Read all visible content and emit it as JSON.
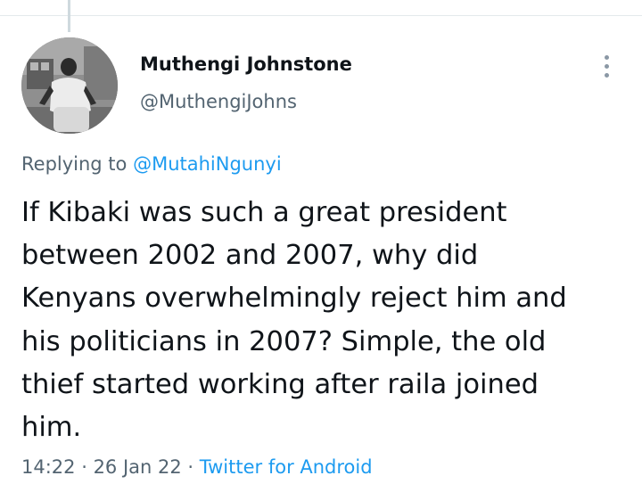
{
  "user": {
    "display_name": "Muthengi Johnstone",
    "handle": "@MuthengiJohns",
    "avatar_icon": "profile-photo"
  },
  "reply": {
    "prefix": "Replying to ",
    "mention": "@MutahiNgunyi"
  },
  "tweet": {
    "lines": [
      "If Kibaki was such a great president",
      "between 2002 and 2007, why did",
      "Kenyans overwhelmingly reject him and",
      "his politicians in 2007? Simple, the old",
      "thief started working after raila joined",
      "him."
    ]
  },
  "meta": {
    "time": "14:22",
    "separator": " · ",
    "date": "26 Jan 22",
    "source": "Twitter for Android"
  },
  "colors": {
    "accent": "#1d9bf0",
    "secondary_text": "#536471",
    "primary_text": "#0f1419"
  },
  "icons": {
    "more": "more-vertical-icon"
  }
}
